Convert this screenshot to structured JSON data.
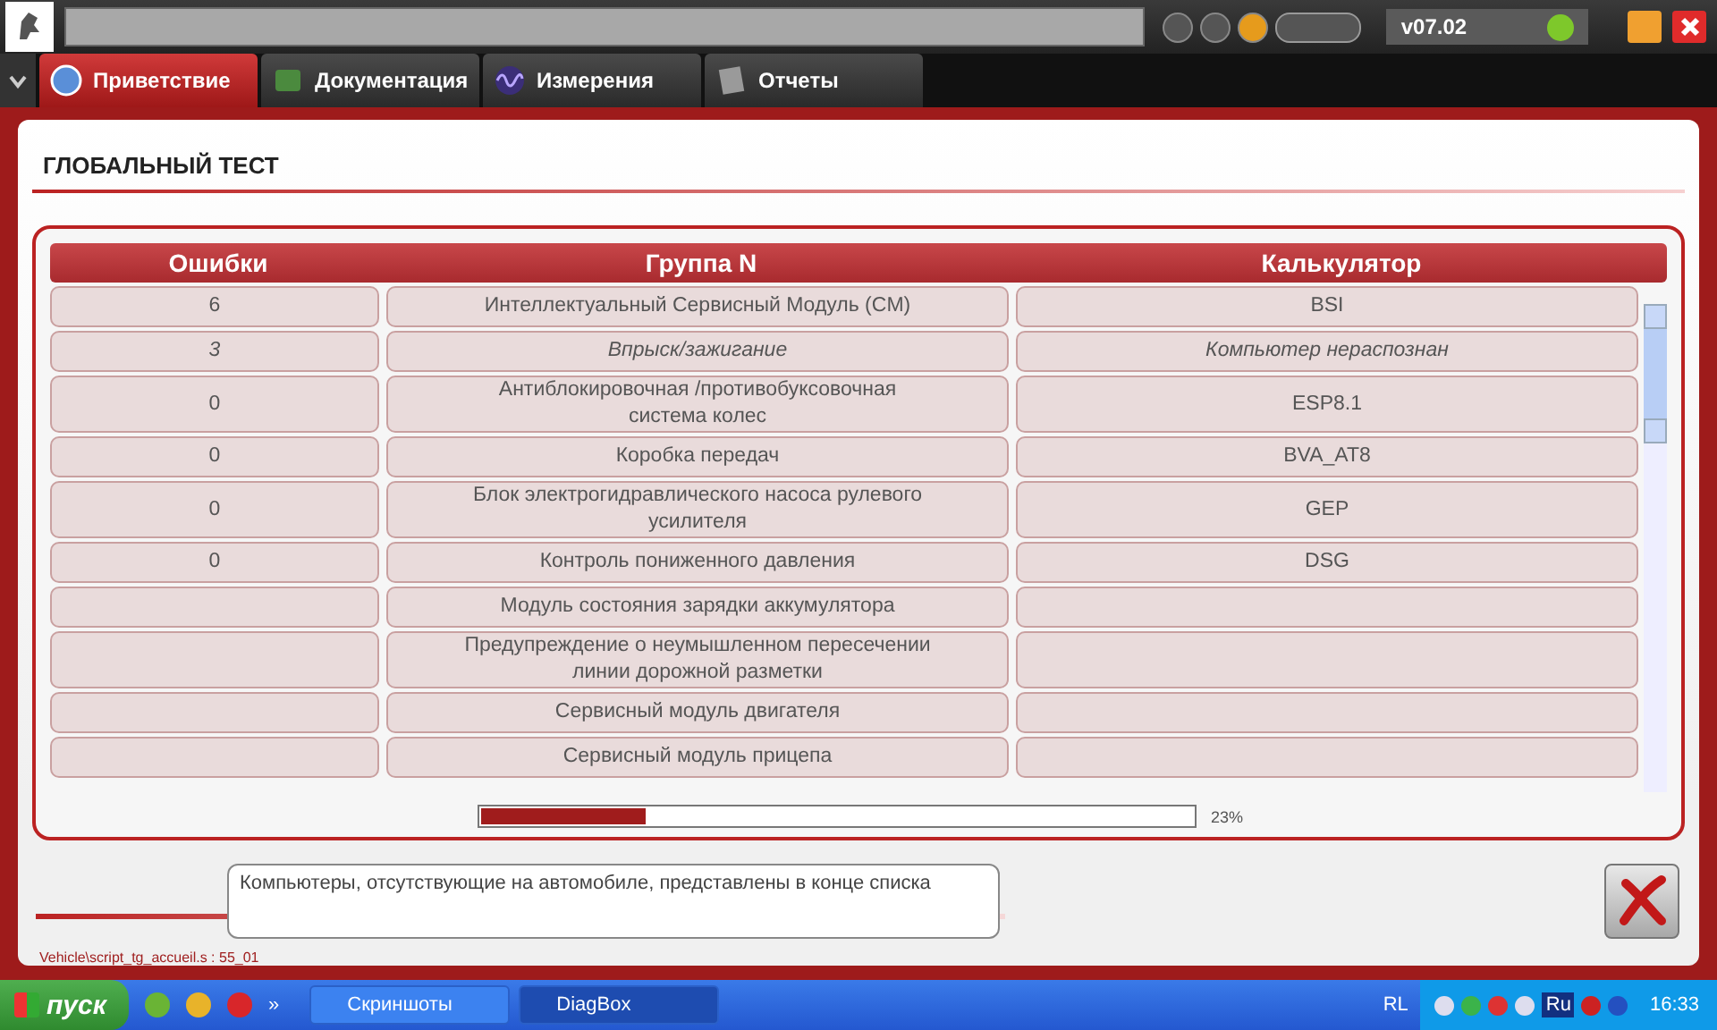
{
  "top_bar": {
    "version": "v07.02"
  },
  "tabs": [
    {
      "label": "Приветствие",
      "selected": true,
      "kind": "globe"
    },
    {
      "label": "Документация",
      "selected": false,
      "kind": "book"
    },
    {
      "label": "Измерения",
      "selected": false,
      "kind": "wave"
    },
    {
      "label": "Отчеты",
      "selected": false,
      "kind": "doc"
    }
  ],
  "page_title": "ГЛОБАЛЬНЫЙ ТЕСТ",
  "table": {
    "columns": [
      "Ошибки",
      "Группа N",
      "Калькулятор"
    ],
    "rows": [
      {
        "errors": "6",
        "group": "Интеллектуальный Сервисный Модуль (CM)",
        "calculator": "BSI",
        "unrecognized": false
      },
      {
        "errors": "3",
        "group": "Впрыск/зажигание",
        "calculator": "Компьютер нераспознан",
        "unrecognized": true
      },
      {
        "errors": "0",
        "group": "Антиблокировочная /противобуксовочная система колес",
        "calculator": "ESP8.1",
        "unrecognized": false
      },
      {
        "errors": "0",
        "group": "Коробка передач",
        "calculator": "BVA_AT8",
        "unrecognized": false
      },
      {
        "errors": "0",
        "group": "Блок электрогидравлического насоса рулевого усилителя",
        "calculator": "GEP",
        "unrecognized": false
      },
      {
        "errors": "0",
        "group": "Контроль пониженного давления",
        "calculator": "DSG",
        "unrecognized": false
      },
      {
        "errors": "",
        "group": "Модуль состояния зарядки аккумулятора",
        "calculator": "",
        "unrecognized": false
      },
      {
        "errors": "",
        "group": "Предупреждение о неумышленном пересечении линии дорожной разметки",
        "calculator": "",
        "unrecognized": false
      },
      {
        "errors": "",
        "group": "Сервисный модуль двигателя",
        "calculator": "",
        "unrecognized": false
      },
      {
        "errors": "",
        "group": "Сервисный модуль прицепа",
        "calculator": "",
        "unrecognized": false
      }
    ]
  },
  "progress": {
    "level": 0.23,
    "reading": "23%"
  },
  "message": "Компьютеры, отсутствующие на автомобиле, представлены в конце списка",
  "footer_path": "Vehicle\\script_tg_accueil.s : 55_01",
  "taskbar": {
    "start": "пуск",
    "more": "»",
    "tasks": [
      {
        "label": "Скриншоты",
        "selected": false
      },
      {
        "label": "DiagBox",
        "selected": true
      }
    ],
    "layout": "RL",
    "language": "Ru",
    "clock": "16:33"
  }
}
